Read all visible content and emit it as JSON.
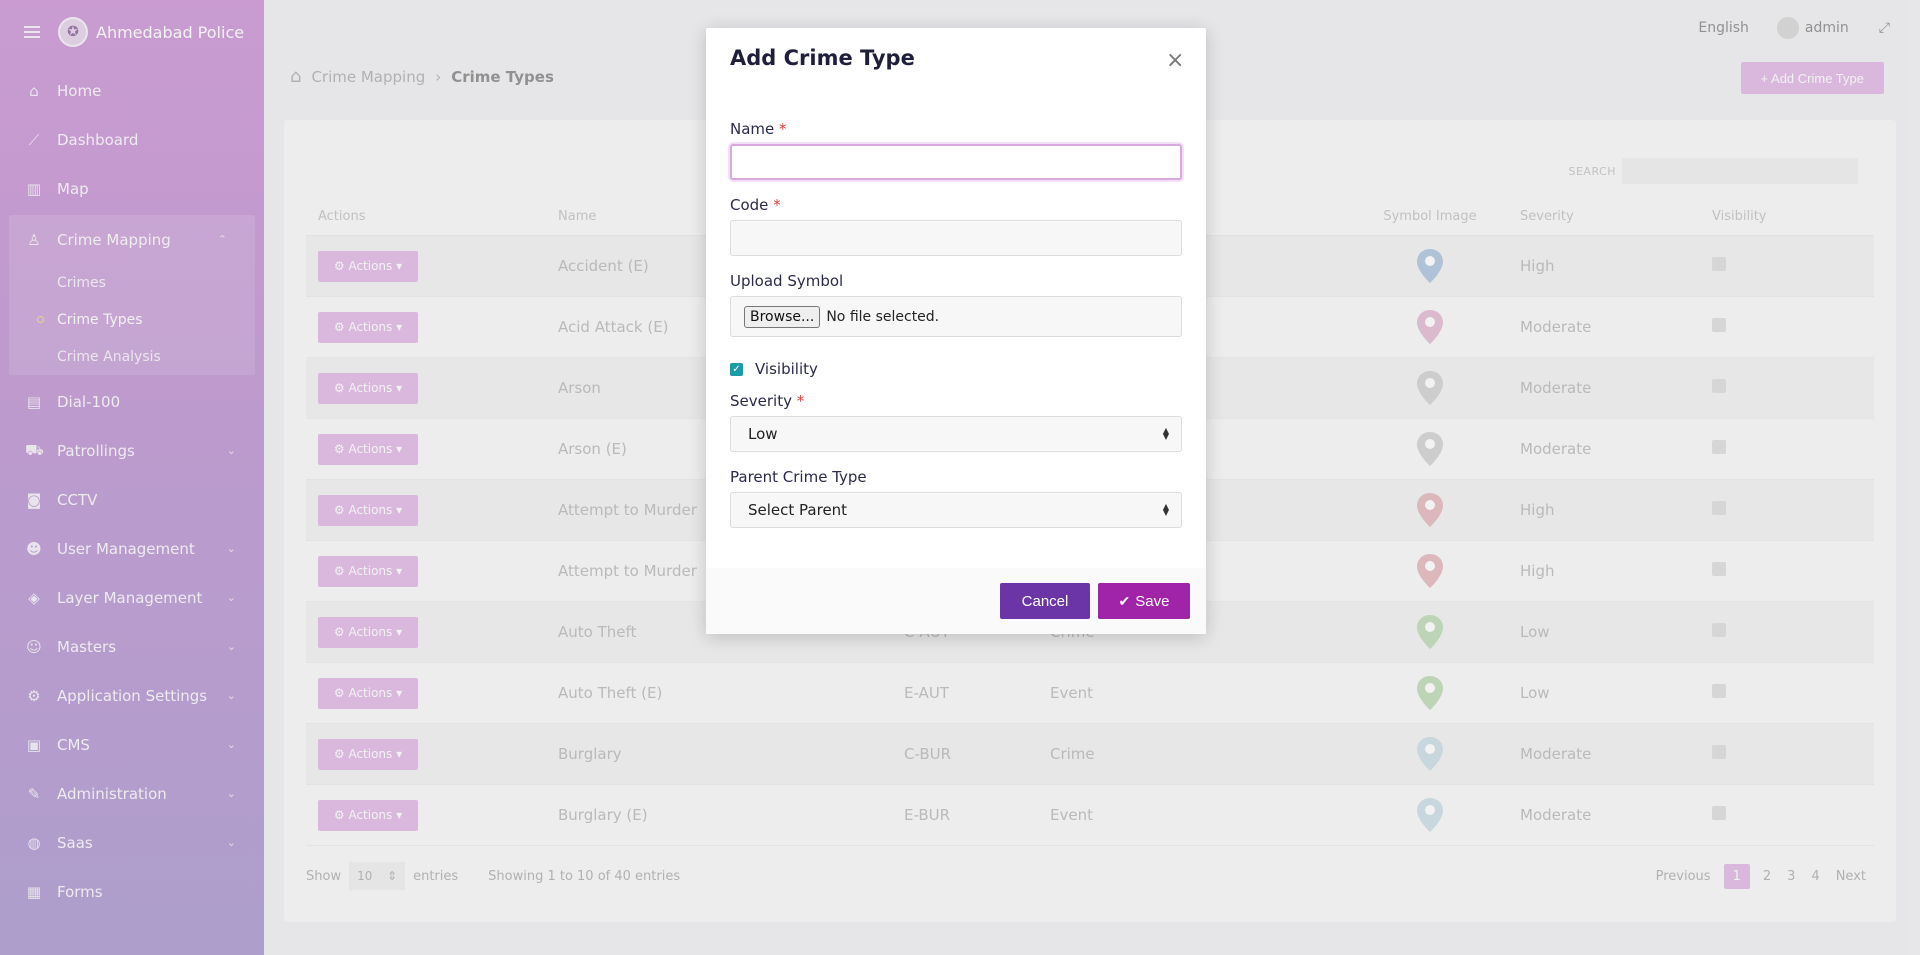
{
  "brand": {
    "name": "Ahmedabad Police"
  },
  "sidebar": {
    "items": [
      {
        "label": "Home",
        "icon": "home-icon",
        "glyph": "⌂"
      },
      {
        "label": "Dashboard",
        "icon": "chart-line-icon",
        "glyph": "⟋"
      },
      {
        "label": "Map",
        "icon": "map-icon",
        "glyph": "▥"
      }
    ],
    "group": {
      "label": "Crime Mapping",
      "icon": "police-icon",
      "glyph": "♙",
      "subitems": [
        {
          "label": "Crimes"
        },
        {
          "label": "Crime Types"
        },
        {
          "label": "Crime Analysis"
        }
      ]
    },
    "items_after": [
      {
        "label": "Dial-100",
        "icon": "phone-icon",
        "glyph": "▤",
        "chev": ""
      },
      {
        "label": "Patrollings",
        "icon": "car-icon",
        "glyph": "⛟",
        "chev": "⌄"
      },
      {
        "label": "CCTV",
        "icon": "camera-icon",
        "glyph": "◙",
        "chev": ""
      },
      {
        "label": "User Management",
        "icon": "users-icon",
        "glyph": "☻",
        "chev": "⌄"
      },
      {
        "label": "Layer Management",
        "icon": "layers-icon",
        "glyph": "◈",
        "chev": "⌄"
      },
      {
        "label": "Masters",
        "icon": "group-icon",
        "glyph": "☺",
        "chev": "⌄"
      },
      {
        "label": "Application Settings",
        "icon": "gears-icon",
        "glyph": "⚙",
        "chev": "⌄"
      },
      {
        "label": "CMS",
        "icon": "cms-icon",
        "glyph": "▣",
        "chev": "⌄"
      },
      {
        "label": "Administration",
        "icon": "wrench-icon",
        "glyph": "✎",
        "chev": "⌄"
      },
      {
        "label": "Saas",
        "icon": "globe-icon",
        "glyph": "◍",
        "chev": "⌄"
      },
      {
        "label": "Forms",
        "icon": "forms-icon",
        "glyph": "▦",
        "chev": ""
      }
    ]
  },
  "topbar": {
    "language": "English",
    "user": "admin"
  },
  "breadcrumb": {
    "parent": "Crime Mapping",
    "current": "Crime Types"
  },
  "page": {
    "add_button": "+ Add Crime Type"
  },
  "table": {
    "search_label": "SEARCH",
    "headers": [
      "Actions",
      "Name",
      "",
      "",
      "Symbol Image",
      "Severity",
      "Visibility"
    ],
    "action_label": "⚙ Actions ▾",
    "rows": [
      {
        "name": "Accident (E)",
        "code": "",
        "category": "",
        "pin_color": "#b9cde4",
        "severity": "High"
      },
      {
        "name": "Acid Attack (E)",
        "code": "",
        "category": "",
        "pin_color": "#e8c4d8",
        "severity": "Moderate"
      },
      {
        "name": "Arson",
        "code": "",
        "category": "",
        "pin_color": "#d8d8d8",
        "severity": "Moderate"
      },
      {
        "name": "Arson (E)",
        "code": "",
        "category": "",
        "pin_color": "#d8d8d8",
        "severity": "Moderate"
      },
      {
        "name": "Attempt to Murder",
        "code": "",
        "category": "",
        "pin_color": "#e8c2c8",
        "severity": "High"
      },
      {
        "name": "Attempt to Murder",
        "code": "",
        "category": "",
        "pin_color": "#e8c2c8",
        "severity": "High"
      },
      {
        "name": "Auto Theft",
        "code": "C-AUT",
        "category": "Crime",
        "pin_color": "#c8e0c0",
        "severity": "Low"
      },
      {
        "name": "Auto Theft (E)",
        "code": "E-AUT",
        "category": "Event",
        "pin_color": "#c8e0c0",
        "severity": "Low"
      },
      {
        "name": "Burglary",
        "code": "C-BUR",
        "category": "Crime",
        "pin_color": "#d3e3ea",
        "severity": "Moderate"
      },
      {
        "name": "Burglary (E)",
        "code": "E-BUR",
        "category": "Event",
        "pin_color": "#d3e3ea",
        "severity": "Moderate"
      }
    ],
    "footer": {
      "show": "Show",
      "length": "10",
      "entries": "entries",
      "info": "Showing 1 to 10 of 40 entries",
      "previous": "Previous",
      "pages": [
        "1",
        "2",
        "3",
        "4"
      ],
      "next": "Next"
    }
  },
  "modal": {
    "title": "Add Crime Type",
    "name_label": "Name",
    "name_value": "",
    "code_label": "Code",
    "code_value": "",
    "upload_label": "Upload Symbol",
    "browse_label": "Browse...",
    "file_status": "No file selected.",
    "visibility_label": "Visibility",
    "visibility_checked": true,
    "severity_label": "Severity",
    "severity_value": "Low",
    "parent_label": "Parent Crime Type",
    "parent_value": "Select Parent",
    "required_marker": "*",
    "cancel_label": "Cancel",
    "save_label": "Save"
  },
  "colors": {
    "sidebar_top": "#d4a4dd",
    "sidebar_bottom": "#b7a7d6",
    "cancel": "#6b35a8",
    "save": "#a024a8",
    "focus": "#d9a8df",
    "checkbox": "#1a9ba5"
  }
}
